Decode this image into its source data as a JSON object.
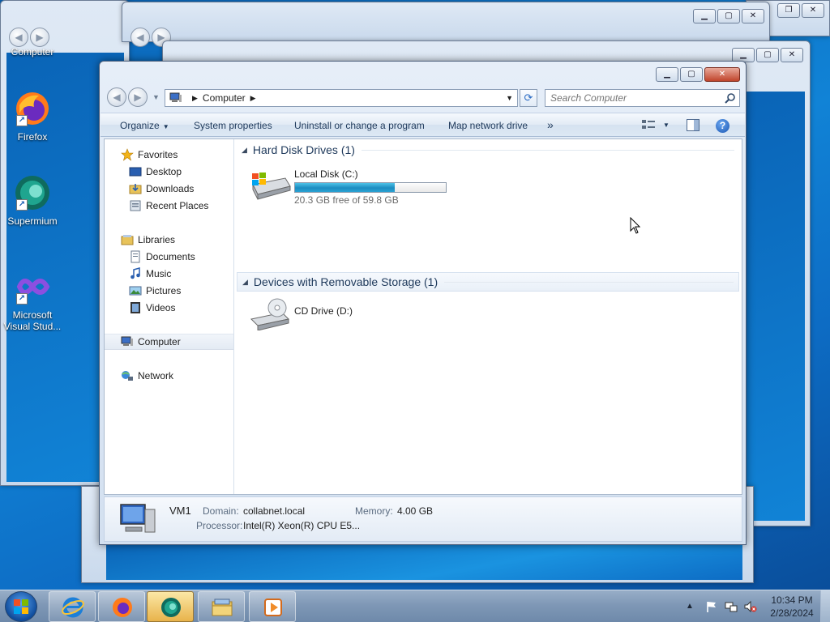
{
  "desktop": {
    "icons": [
      {
        "label": "Computer"
      },
      {
        "label": "Firefox"
      },
      {
        "label": "Supermium"
      },
      {
        "label_line1": "Microsoft",
        "label_line2": "Visual Stud..."
      }
    ]
  },
  "window": {
    "address_path": [
      "Computer"
    ],
    "search_placeholder": "Search Computer",
    "commands": {
      "organize": "Organize",
      "system_properties": "System properties",
      "uninstall": "Uninstall or change a program",
      "map_drive": "Map network drive",
      "more": "»"
    },
    "nav": {
      "favorites": {
        "label": "Favorites",
        "items": [
          "Desktop",
          "Downloads",
          "Recent Places"
        ]
      },
      "libraries": {
        "label": "Libraries",
        "items": [
          "Documents",
          "Music",
          "Pictures",
          "Videos"
        ]
      },
      "computer": "Computer",
      "network": "Network"
    },
    "groups": [
      {
        "header": "Hard Disk Drives (1)",
        "drives": [
          {
            "name": "Local Disk (C:)",
            "free_text": "20.3 GB free of 59.8 GB",
            "used_fraction": 0.66
          }
        ]
      },
      {
        "header": "Devices with Removable Storage (1)",
        "drives": [
          {
            "name": "CD Drive (D:)"
          }
        ]
      }
    ],
    "details": {
      "name": "VM1",
      "domain_label": "Domain:",
      "domain_value": "collabnet.local",
      "memory_label": "Memory:",
      "memory_value": "4.00 GB",
      "processor_label": "Processor:",
      "processor_value": "Intel(R) Xeon(R) CPU E5..."
    }
  },
  "taskbar": {
    "clock_time": "10:34 PM",
    "clock_date": "2/28/2024"
  },
  "colors": {
    "desktop": "#1183d6",
    "usage_bar": "#1c8cc0",
    "close_button": "#c0452c"
  }
}
